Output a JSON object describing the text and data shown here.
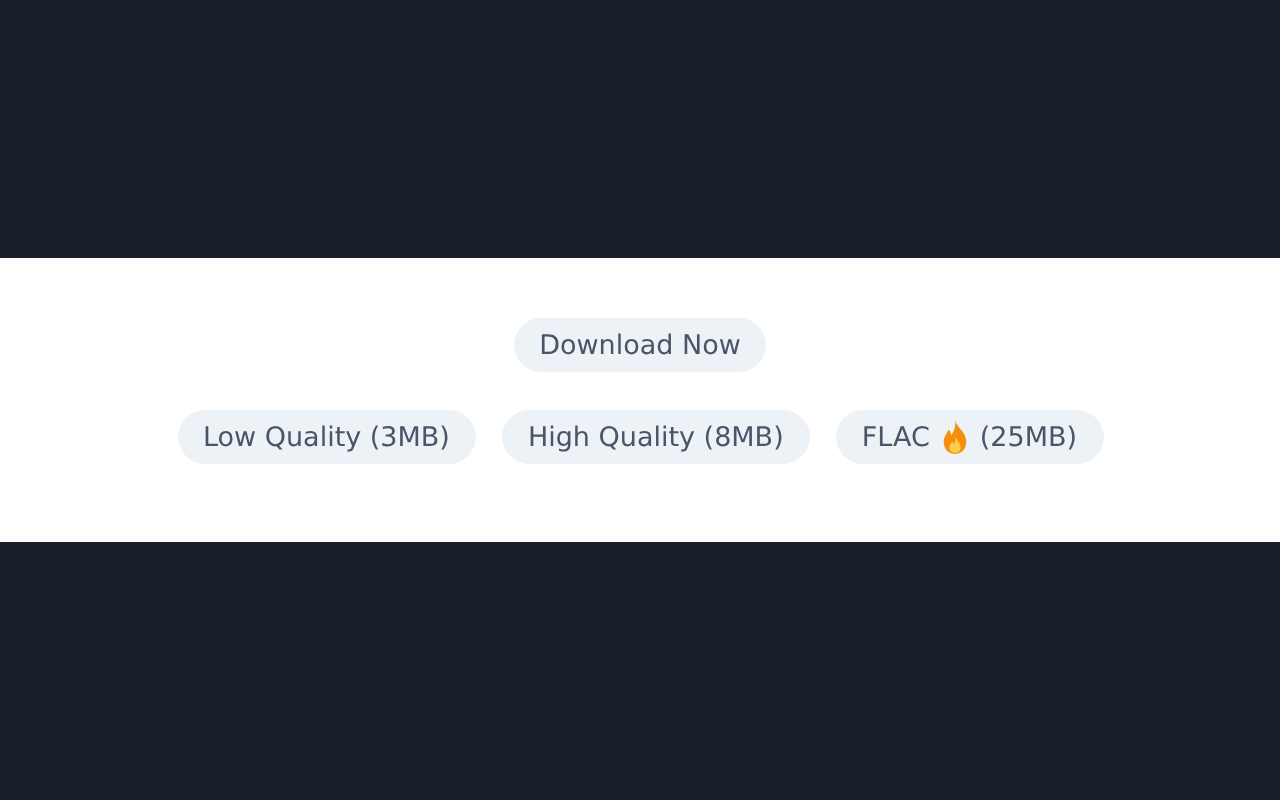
{
  "download_button": {
    "label": "Download Now"
  },
  "options": [
    {
      "label": "Low Quality (3MB)",
      "hot": false
    },
    {
      "label": "High Quality (8MB)",
      "hot": false
    },
    {
      "label": "FLAC",
      "suffix": "(25MB)",
      "hot": true
    }
  ]
}
